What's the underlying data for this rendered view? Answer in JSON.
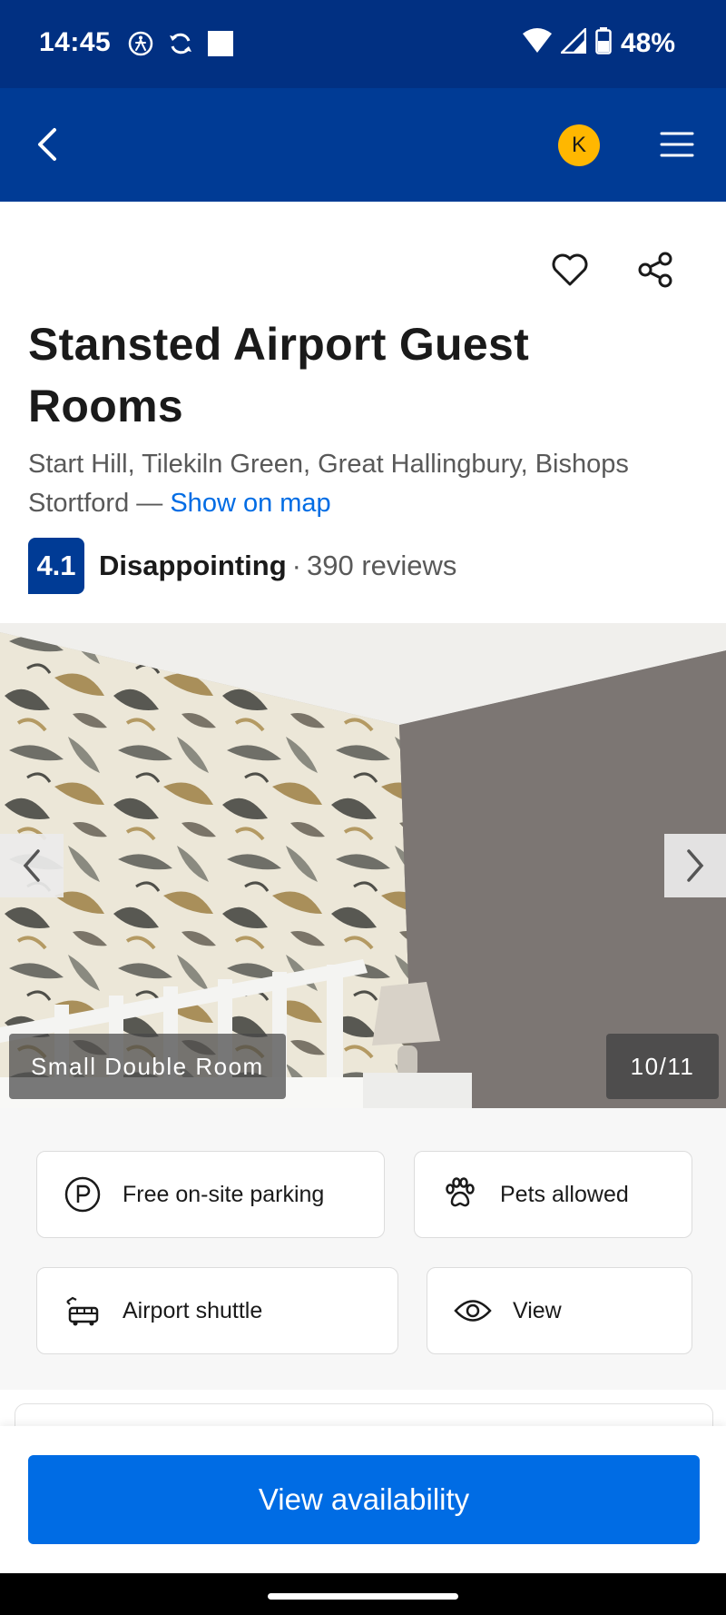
{
  "status_bar": {
    "time": "14:45",
    "battery": "48%",
    "icons": [
      "accessibility-icon",
      "sync-icon",
      "square-notification-icon",
      "wifi-icon",
      "signal-icon",
      "battery-icon"
    ]
  },
  "header": {
    "avatar_initial": "K",
    "icons": [
      "back-arrow-icon",
      "hamburger-menu-icon"
    ]
  },
  "actions": {
    "icons": [
      "heart-icon",
      "share-icon"
    ]
  },
  "hotel": {
    "title": "Stansted Airport Guest Rooms",
    "address": "Start Hill, Tilekiln Green, Great Hallingbury, Bishops Stortford",
    "address_separator": "—",
    "map_link": "Show on map"
  },
  "rating": {
    "score": "4.1",
    "word": "Disappointing",
    "separator": "·",
    "reviews": "390 reviews"
  },
  "gallery": {
    "caption": "Small Double Room",
    "counter": "10/11"
  },
  "amenities": [
    {
      "label": "Free on-site parking",
      "icon": "parking-icon"
    },
    {
      "label": "Pets allowed",
      "icon": "paw-icon"
    },
    {
      "label": "Airport shuttle",
      "icon": "shuttle-bus-icon"
    },
    {
      "label": "View",
      "icon": "eye-icon"
    }
  ],
  "cta": {
    "label": "View availability"
  },
  "colors": {
    "status_bar": "#013082",
    "header": "#003b95",
    "avatar": "#ffb700",
    "link": "#006ce4",
    "primary_button": "#006ce4"
  }
}
